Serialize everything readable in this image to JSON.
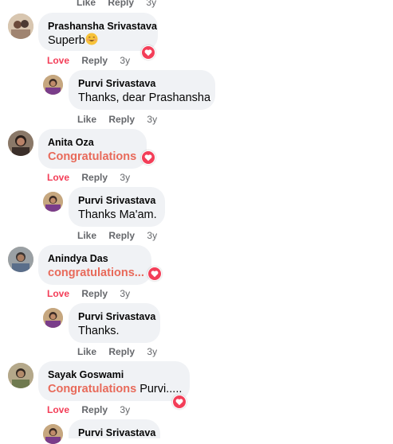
{
  "comments": [
    {
      "top_actions": {
        "like": "Like",
        "reply": "Reply",
        "time": "3y"
      }
    },
    {
      "author": "Prashansha Srivastava",
      "text": "Superb",
      "emoji": "smiling-face-emoji",
      "actions": {
        "like": "Love",
        "reply": "Reply",
        "time": "3y"
      },
      "reaction": "love"
    },
    {
      "author": "Purvi Srivastava",
      "text": "Thanks, dear Prashansha",
      "actions": {
        "like": "Like",
        "reply": "Reply",
        "time": "3y"
      }
    },
    {
      "author": "Anita Oza",
      "highlight": "Congratulations",
      "actions": {
        "like": "Love",
        "reply": "Reply",
        "time": "3y"
      },
      "reaction": "love"
    },
    {
      "author": "Purvi Srivastava",
      "text": "Thanks Ma'am.",
      "actions": {
        "like": "Like",
        "reply": "Reply",
        "time": "3y"
      }
    },
    {
      "author": "Anindya Das",
      "highlight": "congratulations...",
      "actions": {
        "like": "Love",
        "reply": "Reply",
        "time": "3y"
      },
      "reaction": "love"
    },
    {
      "author": "Purvi Srivastava",
      "text": "Thanks.",
      "actions": {
        "like": "Like",
        "reply": "Reply",
        "time": "3y"
      }
    },
    {
      "author": "Sayak Goswami",
      "highlight": "Congratulations",
      "text": " Purvi.....",
      "actions": {
        "like": "Love",
        "reply": "Reply",
        "time": "3y"
      },
      "reaction": "love"
    },
    {
      "author": "Purvi Srivastava"
    }
  ],
  "colors": {
    "bubble": "#f0f2f5",
    "love": "#f33e58",
    "highlight": "#e86a5a",
    "meta": "#65676b"
  }
}
